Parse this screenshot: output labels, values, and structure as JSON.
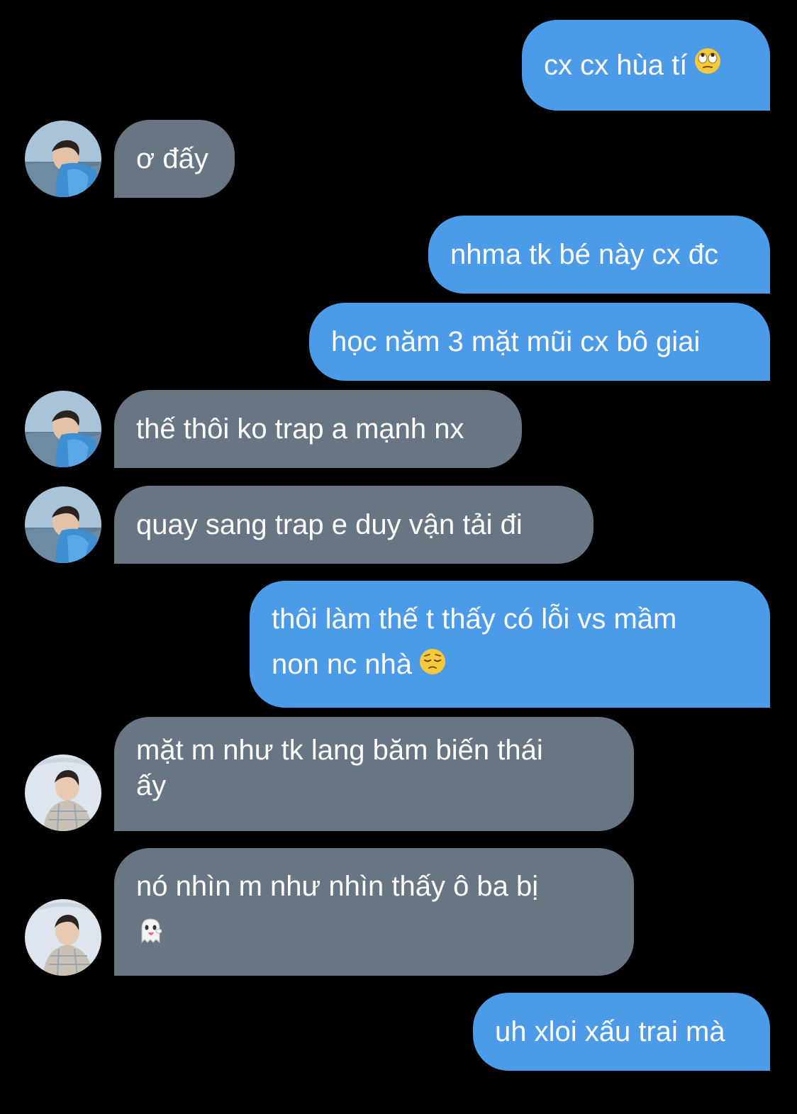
{
  "conversation": {
    "messages": [
      {
        "id": "m1",
        "side": "out",
        "text": "cx cx hùa tí",
        "emoji": "face-with-rolling-eyes-icon"
      },
      {
        "id": "m2",
        "side": "in",
        "text": "ơ đấy"
      },
      {
        "id": "m3",
        "side": "out",
        "text": "nhma tk bé này cx đc"
      },
      {
        "id": "m4",
        "side": "out",
        "text": "học năm 3 mặt mũi cx bô giai"
      },
      {
        "id": "m5",
        "side": "in",
        "text": "thế thôi ko trap a mạnh nx"
      },
      {
        "id": "m6",
        "side": "in",
        "text": "quay sang trap e duy vận tải đi"
      },
      {
        "id": "m7",
        "side": "out",
        "line1": "thôi làm thế t thấy có lỗi vs mầm",
        "line2": "non nc nhà",
        "emoji": "pensive-face-icon"
      },
      {
        "id": "m8",
        "side": "in",
        "line1": "mặt m như tk lang băm biến thái",
        "line2": "ấy"
      },
      {
        "id": "m9",
        "side": "in",
        "line1": "nó nhìn m như nhìn thấy ô ba bị",
        "emoji": "ghost-icon"
      },
      {
        "id": "m10",
        "side": "out",
        "text": "uh xloi xấu trai mà"
      }
    ]
  },
  "colors": {
    "background": "#000000",
    "outgoing_bubble": "#4c9be8",
    "incoming_bubble": "#687583",
    "text": "#ffffff"
  }
}
